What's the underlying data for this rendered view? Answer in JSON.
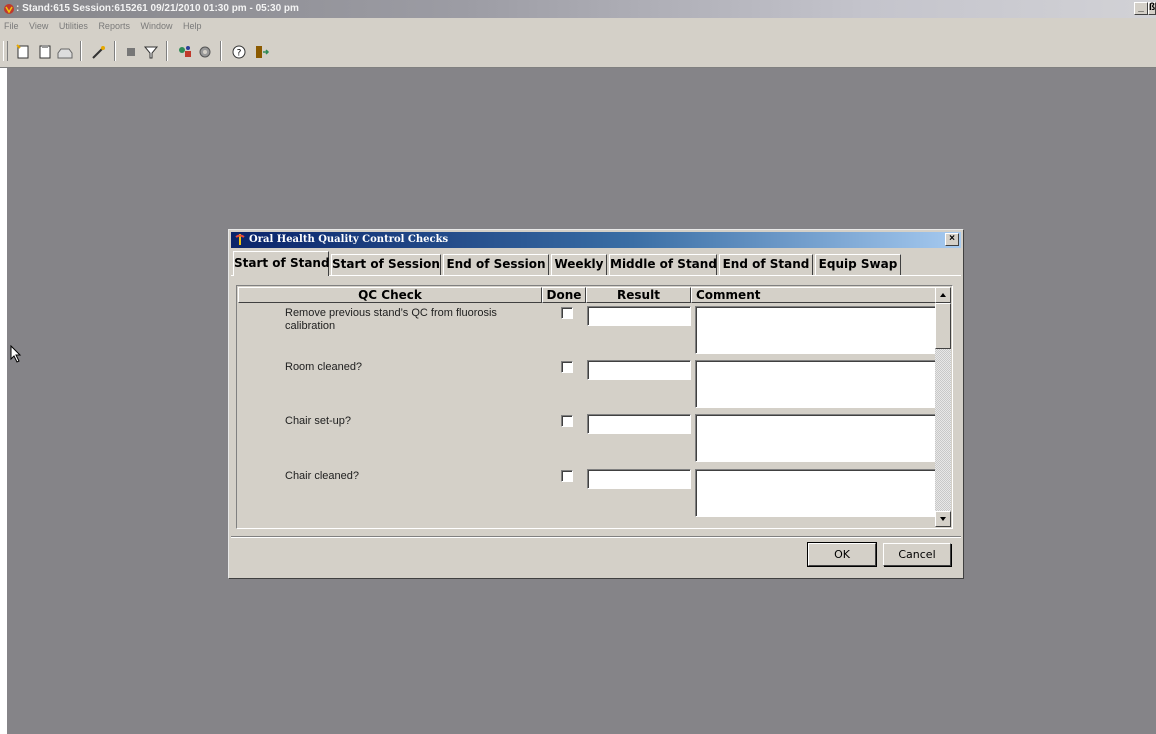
{
  "app": {
    "title": ": Stand:615 Session:615261 09/21/2010 01:30 pm - 05:30 pm",
    "minimize_label": "_",
    "restore_label": "ß",
    "menu": [
      "File",
      "View",
      "Utilities",
      "Reports",
      "Window",
      "Help"
    ],
    "toolbar_icons": [
      "new-document-icon",
      "clipboard-icon",
      "inbox-icon",
      "wand-icon",
      "stop-icon",
      "filter-icon",
      "tools-icon",
      "gear-icon",
      "help-icon",
      "exit-door-icon"
    ]
  },
  "dialog": {
    "title": "Oral Health Quality Control Checks",
    "close_label": "×",
    "tabs": [
      "Start of Stand",
      "Start of Session",
      "End of Session",
      "Weekly",
      "Middle of Stand",
      "End of Stand",
      "Equip Swap"
    ],
    "active_tab": "Start of Stand",
    "columns": {
      "qc_check": "QC Check",
      "done": "Done",
      "result": "Result",
      "comment": "Comment"
    },
    "rows": [
      {
        "check": "Remove previous stand’s QC from fluorosis calibration",
        "done": false,
        "result": "",
        "comment": ""
      },
      {
        "check": "Room cleaned?",
        "done": false,
        "result": "",
        "comment": ""
      },
      {
        "check": "Chair set-up?",
        "done": false,
        "result": "",
        "comment": ""
      },
      {
        "check": "Chair cleaned?",
        "done": false,
        "result": "",
        "comment": ""
      }
    ],
    "ok_label": "OK",
    "cancel_label": "Cancel"
  },
  "colors": {
    "desktop": "#858488",
    "dialog_face": "#d4d0c8",
    "dialog_title_start": "#0a246a",
    "dialog_title_end": "#a6caf0"
  }
}
